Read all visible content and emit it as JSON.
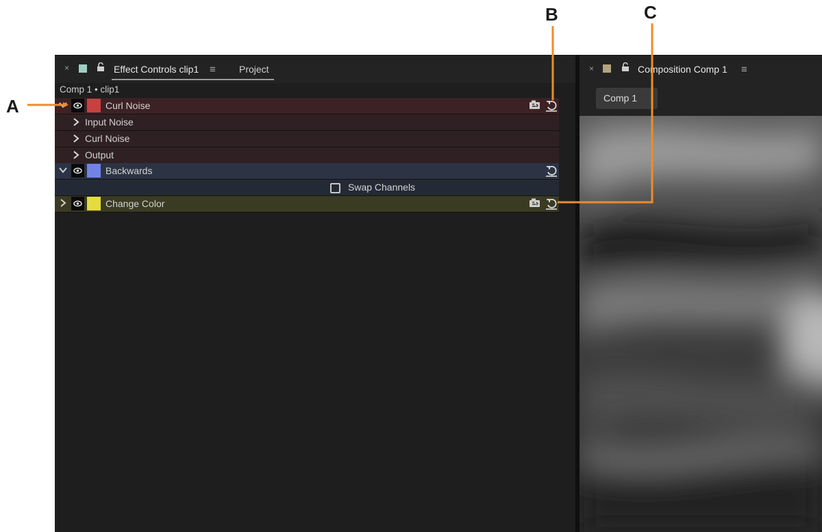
{
  "effect_controls": {
    "close_glyph": "×",
    "tab_title": "Effect Controls clip1",
    "menu_glyph": "≡",
    "project_tab": "Project",
    "breadcrumb": "Comp 1 • clip1",
    "effects": [
      {
        "name": "Curl Noise",
        "color": "#c84141",
        "expanded": true,
        "properties": [
          "Input Noise",
          "Curl Noise",
          "Output"
        ],
        "has_preset_icon": true,
        "has_reset_icon": true
      },
      {
        "name": "Backwards",
        "color": "#7184e6",
        "expanded": true,
        "checkbox_label": "Swap Channels",
        "checkbox_checked": false,
        "has_preset_icon": false,
        "has_reset_icon": true
      },
      {
        "name": "Change Color",
        "color": "#e3dc3f",
        "expanded": false,
        "has_preset_icon": true,
        "has_reset_icon": true
      }
    ]
  },
  "composition": {
    "close_glyph": "×",
    "tab_title": "Composition Comp 1",
    "menu_glyph": "≡",
    "comp_tab": "Comp 1"
  },
  "callouts": {
    "a": "A",
    "b": "B",
    "c": "C",
    "color": "#ee8c2a"
  }
}
